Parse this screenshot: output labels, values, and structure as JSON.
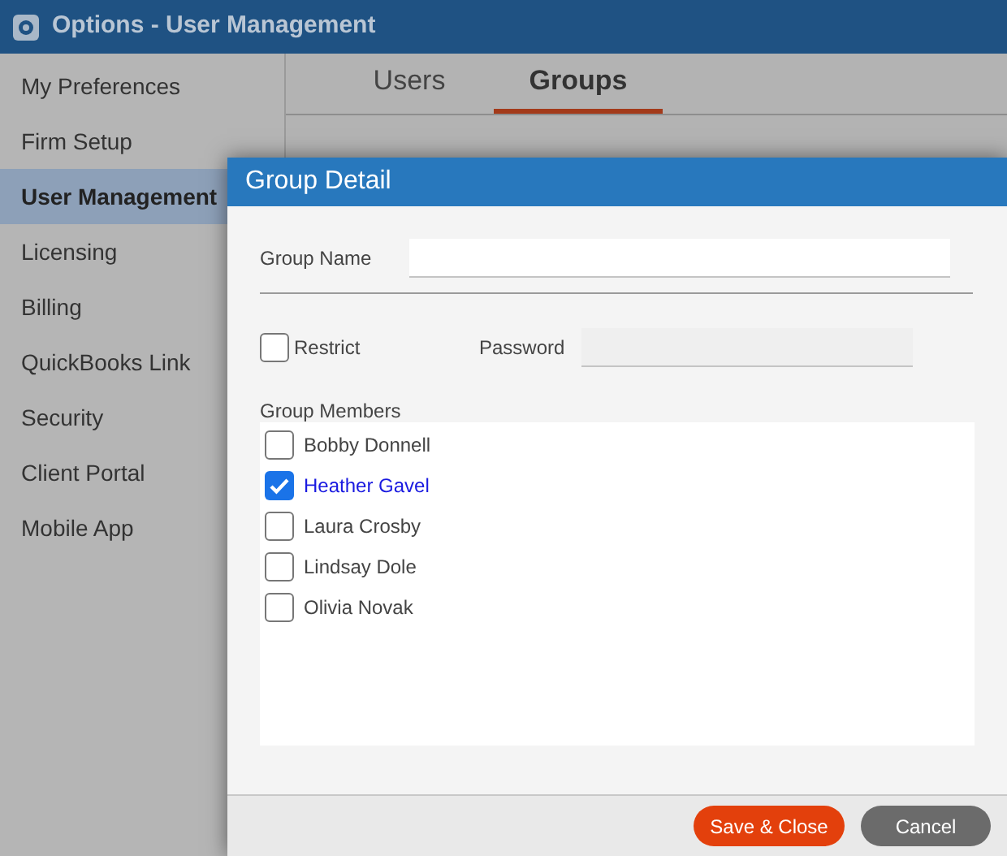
{
  "window": {
    "title": "Options - User Management"
  },
  "sidebar": {
    "items": [
      {
        "label": "My Preferences",
        "selected": false
      },
      {
        "label": "Firm Setup",
        "selected": false
      },
      {
        "label": "User Management",
        "selected": true
      },
      {
        "label": "Licensing",
        "selected": false
      },
      {
        "label": "Billing",
        "selected": false
      },
      {
        "label": "QuickBooks Link",
        "selected": false
      },
      {
        "label": "Security",
        "selected": false
      },
      {
        "label": "Client Portal",
        "selected": false
      },
      {
        "label": "Mobile App",
        "selected": false
      }
    ]
  },
  "tabs": [
    {
      "label": "Users",
      "selected": false
    },
    {
      "label": "Groups",
      "selected": true
    }
  ],
  "dialog": {
    "title": "Group Detail",
    "group_name": {
      "label": "Group Name"
    },
    "restrict": {
      "label": "Restrict",
      "checked": false
    },
    "password": {
      "label": "Password",
      "disabled": true
    },
    "members_label": "Group Members",
    "members": [
      {
        "name": "Bobby Donnell",
        "checked": false
      },
      {
        "name": "Heather Gavel",
        "checked": true
      },
      {
        "name": "Laura Crosby",
        "checked": false
      },
      {
        "name": "Lindsay Dole",
        "checked": false
      },
      {
        "name": "Olivia Novak",
        "checked": false
      }
    ],
    "buttons": [
      {
        "label": "Save & Close",
        "kind": "primary"
      },
      {
        "label": "Cancel",
        "kind": "secondary"
      }
    ]
  }
}
